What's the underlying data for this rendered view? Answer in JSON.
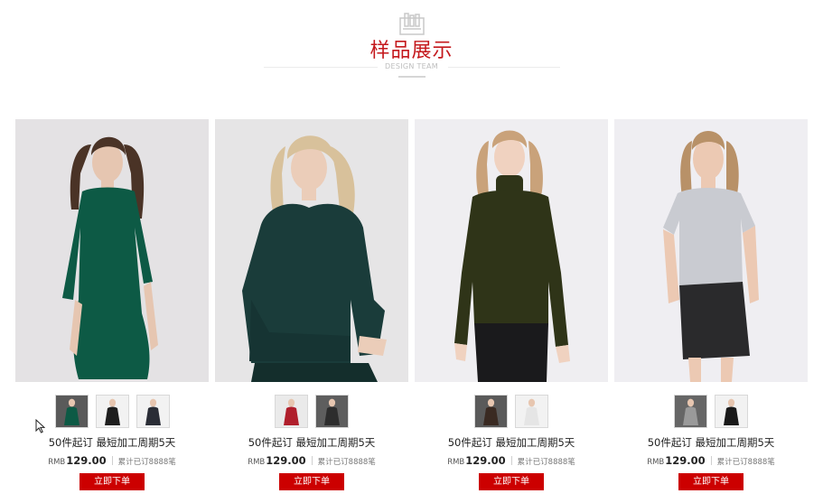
{
  "header": {
    "title": "样品展示",
    "subtitle": "DESIGN TEAM",
    "icon": "clipboard-icon"
  },
  "products": [
    {
      "moq_text": "50件起订 最短加工周期5天",
      "currency": "RMB",
      "price": "129.00",
      "sold": "累计已订8888笔",
      "button": "立即下单",
      "garment": "green-dress",
      "colors": {
        "bg": "#e4e2e4",
        "garment": "#0d5a45",
        "hair": "#4a3326",
        "skin": "#e6c6b1"
      },
      "thumbs": [
        {
          "bg": "#5a5a5a",
          "garment": "#0d5a45"
        },
        {
          "bg": "#f2f2f2",
          "garment": "#1e1e1e"
        },
        {
          "bg": "#f2f2f2",
          "garment": "#2a2d36"
        }
      ]
    },
    {
      "moq_text": "50件起订 最短加工周期5天",
      "currency": "RMB",
      "price": "129.00",
      "sold": "累计已订8888笔",
      "button": "立即下单",
      "garment": "knit-sweater",
      "colors": {
        "bg": "#e6e5e6",
        "garment": "#1a3c3a",
        "hair": "#d8c19b",
        "skin": "#ebcdb9"
      },
      "thumbs": [
        {
          "bg": "#eaeaea",
          "garment": "#b01f2c"
        },
        {
          "bg": "#5e5e5e",
          "garment": "#2d2d2d"
        }
      ]
    },
    {
      "moq_text": "50件起订 最短加工周期5天",
      "currency": "RMB",
      "price": "129.00",
      "sold": "累计已订8888笔",
      "button": "立即下单",
      "garment": "turtleneck",
      "colors": {
        "bg": "#efeef1",
        "garment": "#2f3418",
        "hair": "#c9a27a",
        "skin": "#f0d2c0"
      },
      "thumbs": [
        {
          "bg": "#5a5a5a",
          "garment": "#3a2a22"
        },
        {
          "bg": "#f2f2f2",
          "garment": "#e5e5e5"
        }
      ]
    },
    {
      "moq_text": "50件起订 最短加工周期5天",
      "currency": "RMB",
      "price": "129.00",
      "sold": "累计已订8888笔",
      "button": "立即下单",
      "garment": "tshirt",
      "colors": {
        "bg": "#efeef2",
        "garment": "#c9cbd1",
        "hair": "#b89168",
        "skin": "#ecc9b3"
      },
      "thumbs": [
        {
          "bg": "#666666",
          "garment": "#9a9a9a"
        },
        {
          "bg": "#f2f2f2",
          "garment": "#1a1a1a"
        }
      ]
    }
  ]
}
